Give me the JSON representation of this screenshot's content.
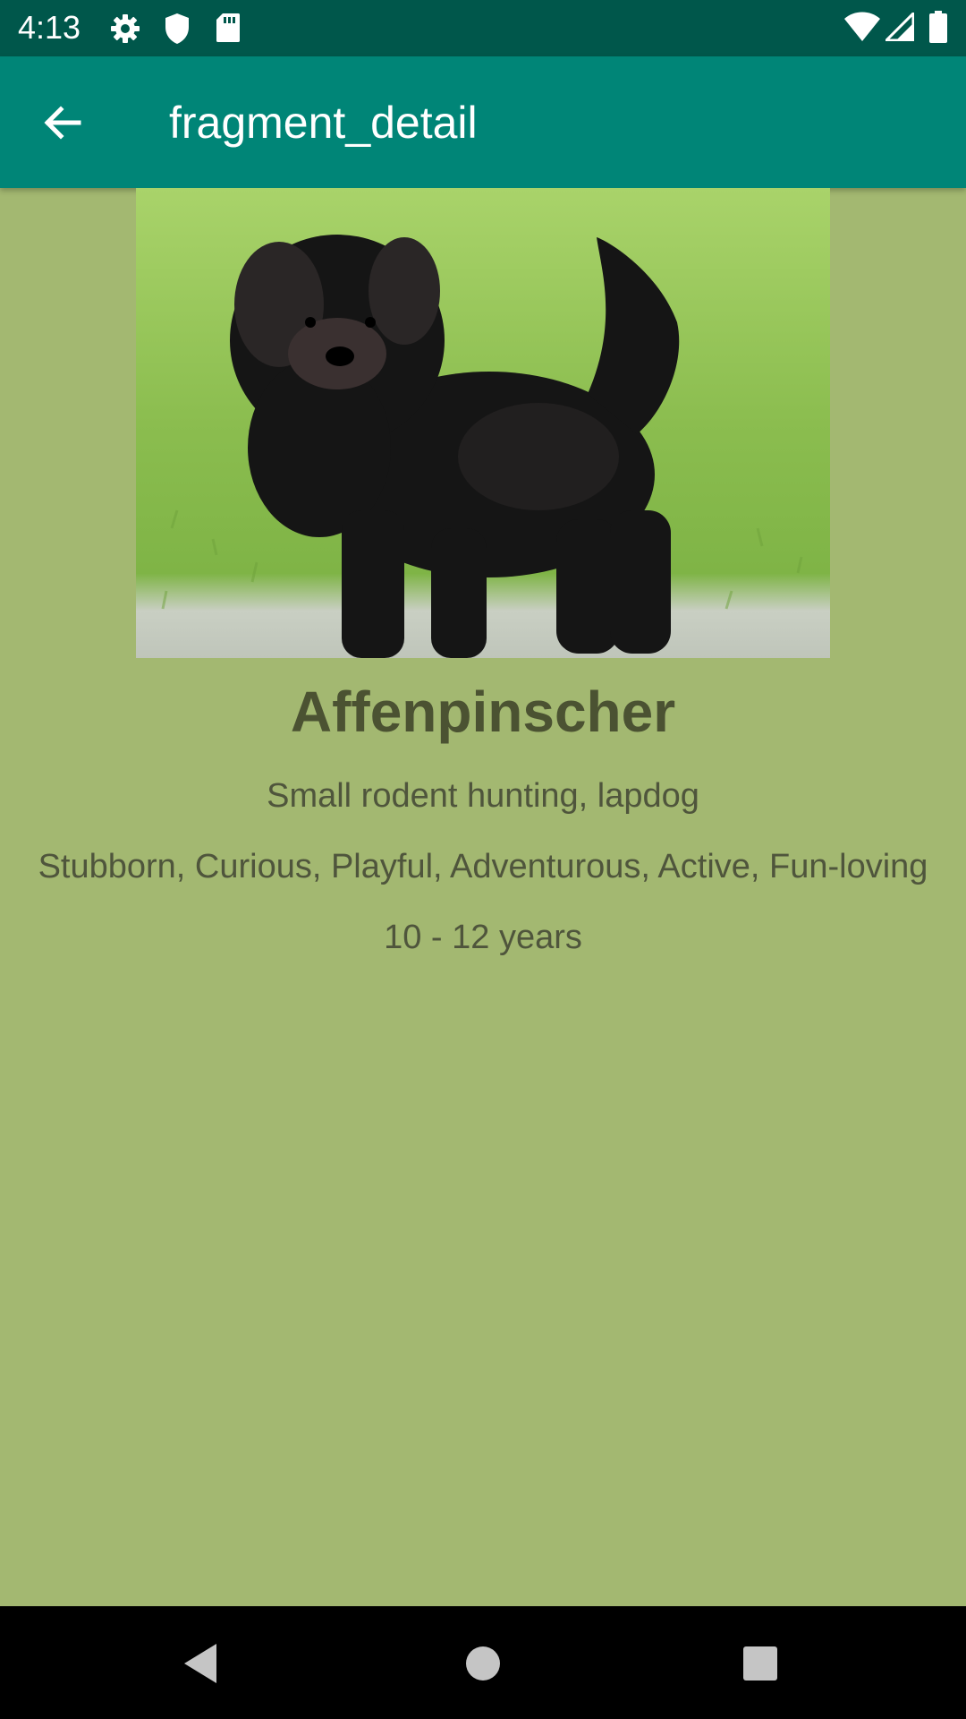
{
  "status_bar": {
    "time": "4:13",
    "left_icons": [
      "gear-icon",
      "shield-icon",
      "sd-card-icon"
    ],
    "right_icons": [
      "wifi-icon",
      "cellular-signal-icon",
      "battery-icon"
    ]
  },
  "app_bar": {
    "back_icon": "arrow-back-icon",
    "title": "fragment_detail"
  },
  "detail": {
    "image_subject": "dog-photo",
    "breed_name": "Affenpinscher",
    "bred_for": "Small rodent hunting, lapdog",
    "temperament": "Stubborn, Curious, Playful, Adventurous, Active, Fun-loving",
    "life_span": "10 - 12 years"
  },
  "nav_bar": {
    "buttons": [
      "back-triangle-icon",
      "home-circle-icon",
      "recents-square-icon"
    ]
  },
  "colors": {
    "status_bar": "#00574b",
    "app_bar": "#008577",
    "background": "#a3b871",
    "title_text": "#4b5232"
  }
}
